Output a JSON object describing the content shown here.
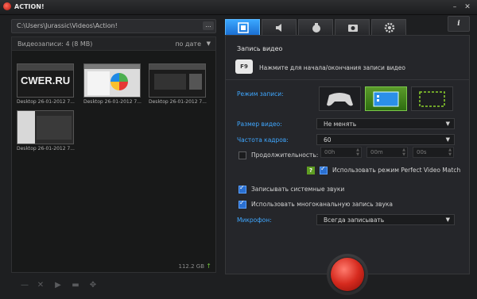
{
  "app": {
    "title": "ACTION!",
    "window_controls": {
      "minimize": "–",
      "close": "✕"
    }
  },
  "left": {
    "path": "C:\\Users\\Jurassic\\Videos\\Action!",
    "browse_label": "...",
    "files_count": "Видеозаписи: 4 (8 MB)",
    "sort_label": "по дате",
    "thumbnails": [
      {
        "label": "Desktop 26-01-2012 7...",
        "overlay": "CWER.RU"
      },
      {
        "label": "Desktop 26-01-2012 7...",
        "overlay": ""
      },
      {
        "label": "Desktop 26-01-2012 7...",
        "overlay": ""
      },
      {
        "label": "Desktop 26-01-2012 7...",
        "overlay": ""
      }
    ],
    "disk_free": "112.2 GB",
    "toolbar_icons": [
      "minus-icon",
      "close-icon",
      "play-icon",
      "folder-icon",
      "move-icon"
    ]
  },
  "tabs": [
    {
      "icon": "film-icon",
      "active": true
    },
    {
      "icon": "speaker-icon",
      "active": false
    },
    {
      "icon": "controller-icon",
      "active": false
    },
    {
      "icon": "camera-icon",
      "active": false
    },
    {
      "icon": "gear-icon",
      "active": false
    }
  ],
  "info_label": "i",
  "settings": {
    "section_title": "Запись видео",
    "hotkey": "F9",
    "hotkey_desc": "Нажмите для начала/окончания записи видео",
    "record_mode_label": "Режим записи:",
    "video_size_label": "Размер видео:",
    "video_size_value": "Не менять",
    "framerate_label": "Частота кадров:",
    "framerate_value": "60",
    "duration_label": "Продолжительность:",
    "duration": {
      "hours": "00h",
      "minutes": "00m",
      "seconds": "00s"
    },
    "duration_checked": false,
    "perfect_match_help": "?",
    "perfect_match_label": "Использовать режим Perfect Video Match",
    "perfect_match_checked": true,
    "system_sounds_label": "Записывать системные звуки",
    "system_sounds_checked": true,
    "multichannel_label": "Использовать многоканальную запись звука",
    "multichannel_checked": true,
    "mic_label": "Микрофон:",
    "mic_value": "Всегда записывать"
  },
  "colors": {
    "accent": "#3fa7ff",
    "active_tab": "#1b6fd2",
    "selected_mode": "#4c8a1f",
    "record": "#d62a1e"
  }
}
